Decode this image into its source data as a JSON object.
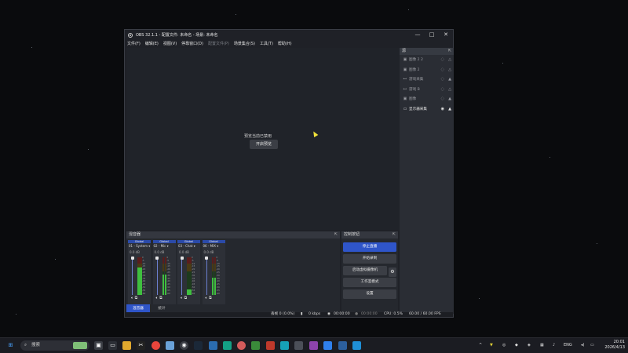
{
  "window": {
    "title": "OBS 32.1.1 - 配置文件: 未命名 - 场景: 未命名",
    "controls": [
      "—",
      "□",
      "✕"
    ]
  },
  "menu": [
    {
      "label": "文件(F)",
      "enabled": true
    },
    {
      "label": "编辑(E)",
      "enabled": true
    },
    {
      "label": "视图(V)",
      "enabled": true
    },
    {
      "label": "停靠窗口(D)",
      "enabled": true
    },
    {
      "label": "配置文件(P)",
      "enabled": false
    },
    {
      "label": "场景集合(S)",
      "enabled": true
    },
    {
      "label": "工具(T)",
      "enabled": true
    },
    {
      "label": "帮助(H)",
      "enabled": true
    }
  ],
  "preview": {
    "message": "预览当前已禁用",
    "enable_button": "开启预览"
  },
  "sources": {
    "title": "源",
    "items": [
      {
        "label": "图像 2 2",
        "icon": "image-icon",
        "visible": false,
        "locked": false
      },
      {
        "label": "图像 2",
        "icon": "image-icon",
        "visible": false,
        "locked": false
      },
      {
        "label": "游戏采集",
        "icon": "gamepad-icon",
        "visible": false,
        "locked": true
      },
      {
        "label": "游戏 B",
        "icon": "gamepad-icon",
        "visible": false,
        "locked": false
      },
      {
        "label": "图像",
        "icon": "image-icon",
        "visible": false,
        "locked": true
      },
      {
        "label": "显示器采集",
        "icon": "monitor-icon",
        "visible": true,
        "locked": true
      }
    ]
  },
  "mixer": {
    "title": "混音器",
    "channels": [
      {
        "tag": "Global",
        "name": "01 - System",
        "db": "0.0 dB",
        "level": 0.72
      },
      {
        "tag": "Global",
        "name": "02 - Mic",
        "db": "0.0 dB",
        "level": 0.55
      },
      {
        "tag": "Global",
        "name": "03 - Chat",
        "db": "0.0 dB",
        "level": 0.15
      },
      {
        "tag": "Global",
        "name": "06 - MIX",
        "db": "0.0 dB",
        "level": 0.45
      }
    ],
    "scale": [
      "0",
      "-5",
      "-10",
      "-15",
      "-20",
      "-25",
      "-30",
      "-35",
      "-40",
      "-45",
      "-50",
      "-55",
      "-60"
    ],
    "tabs": [
      "混音器",
      "统计"
    ]
  },
  "controls": {
    "title": "控制按钮",
    "buttons": [
      "停止直播",
      "开始录制",
      "启动虚拟摄像机",
      "工作室模式",
      "设置"
    ]
  },
  "status": {
    "dropped": "丢帧 0 (0.0%)",
    "kbps": "0 kbps",
    "live_time": "00:00:00",
    "rec_time": "00:00:00",
    "cpu": "CPU: 0.5%",
    "fps": "60.00 / 60.00 FPS"
  },
  "taskbar": {
    "search_placeholder": "搜索",
    "lang": "ENG",
    "time": "20:01",
    "date": "2026/4/13"
  },
  "colors": {
    "accent": "#2f55c9",
    "window_bg": "#1f2127",
    "meter_green": "#3fbf3f"
  }
}
